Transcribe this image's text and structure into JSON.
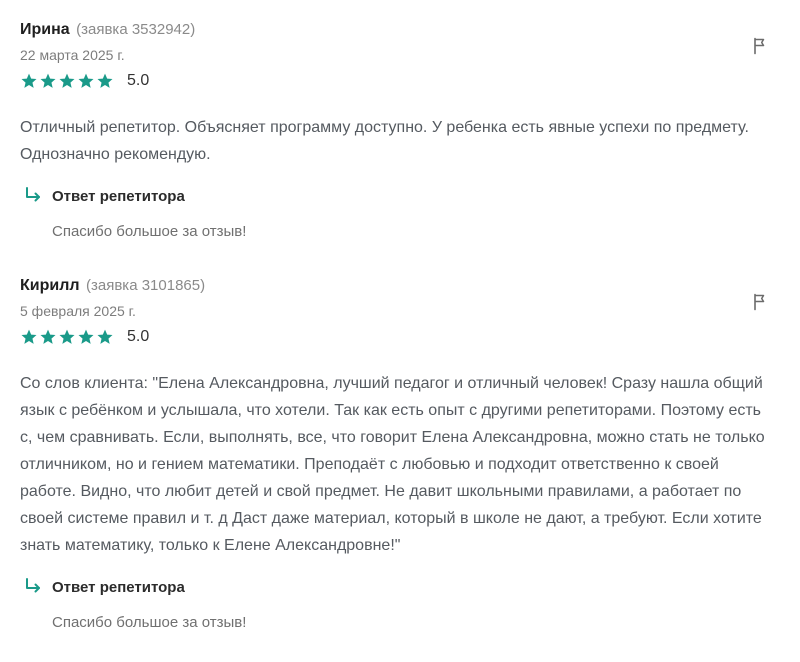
{
  "colors": {
    "star": "#1a9a89",
    "reply_arrow": "#1a9a89",
    "review_text": "#555a60",
    "muted": "#8a8a8a"
  },
  "reviews": [
    {
      "author": "Ирина",
      "order_ref": "(заявка 3532942)",
      "date": "22 марта 2025 г.",
      "stars": 5,
      "rating": "5.0",
      "text": "Отличный репетитор. Объясняет программу доступно. У ребенка есть явные успехи по предмету. Однозначно рекомендую.",
      "reply_title": "Ответ репетитора",
      "reply_text": "Спасибо большое за отзыв!",
      "flag_icon": "flag-icon"
    },
    {
      "author": "Кирилл",
      "order_ref": "(заявка 3101865)",
      "date": "5 февраля 2025 г.",
      "stars": 5,
      "rating": "5.0",
      "text": "Со слов клиента: \"Елена Александровна, лучший педагог и отличный человек! Сразу нашла общий язык с ребёнком и услышала, что хотели. Так как есть опыт с другими репетиторами. Поэтому есть с, чем сравнивать. Если, выполнять, все, что говорит Елена Александровна, можно стать не только отличником, но и гением математики. Преподаёт с любовью и подходит ответственно к своей работе. Видно, что любит детей и свой предмет. Не давит школьными правилами, а работает по своей системе правил и т. д Даст даже материал, который в школе не дают, а требуют. Если хотите знать математику, только к Елене Александровне!\"",
      "reply_title": "Ответ репетитора",
      "reply_text": "Спасибо большое за отзыв!",
      "flag_icon": "flag-icon"
    }
  ]
}
